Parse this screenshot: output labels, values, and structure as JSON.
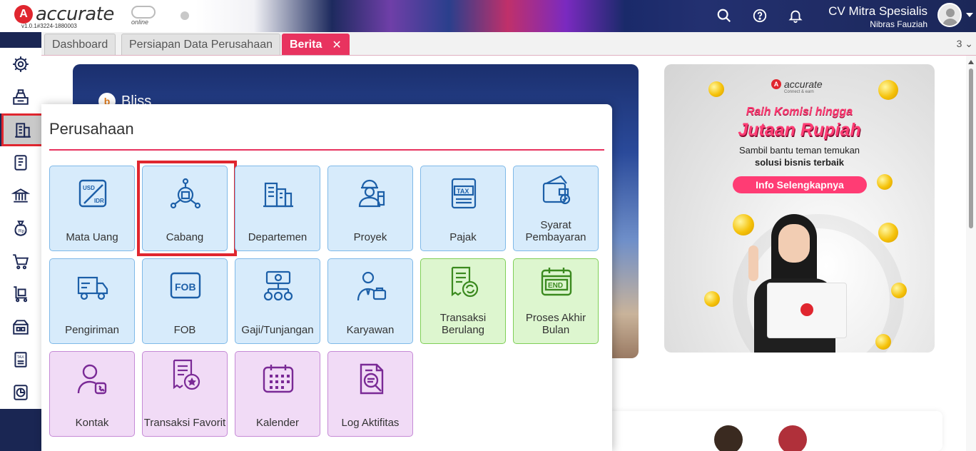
{
  "app": {
    "brand": "accurate",
    "brand_suffix": "online",
    "version": "v1.0.1#3224-1880003",
    "company_name": "CV Mitra Spesialis",
    "user_name": "Nibras Fauziah"
  },
  "topbar": {
    "icons": [
      "search-icon",
      "help-icon",
      "bell-icon"
    ]
  },
  "tabs": [
    {
      "label": "Dashboard",
      "active": false
    },
    {
      "label": "Persiapan Data Perusahaan",
      "active": false
    },
    {
      "label": "Berita",
      "active": true,
      "closable": true
    }
  ],
  "tab_count": "3",
  "sidebar": {
    "items": [
      {
        "icon": "settings-icon"
      },
      {
        "icon": "cash-register-icon"
      },
      {
        "icon": "company-icon",
        "active": true
      },
      {
        "icon": "ledger-icon"
      },
      {
        "icon": "bank-icon"
      },
      {
        "icon": "money-bag-icon"
      },
      {
        "icon": "cart-icon"
      },
      {
        "icon": "trolley-icon"
      },
      {
        "icon": "inventory-icon"
      },
      {
        "icon": "tax-icon"
      },
      {
        "icon": "report-icon"
      }
    ]
  },
  "banner_left": {
    "brand": "Bliss"
  },
  "ad": {
    "brand": "accurate",
    "brand_sub": "Connect & earn",
    "headline1": "Raih Komisi hingga",
    "headline2": "Jutaan Rupiah",
    "line1": "Sambil bantu teman temukan",
    "line2": "solusi bisnis terbaik",
    "cta": "Info Selengkapnya"
  },
  "menu": {
    "title": "Perusahaan",
    "tiles": [
      {
        "label": "Mata Uang",
        "color": "blue",
        "icon": "currency-exchange-icon"
      },
      {
        "label": "Cabang",
        "color": "blue",
        "icon": "branch-icon",
        "highlighted": true
      },
      {
        "label": "Departemen",
        "color": "blue",
        "icon": "department-building-icon"
      },
      {
        "label": "Proyek",
        "color": "blue",
        "icon": "project-worker-icon"
      },
      {
        "label": "Pajak",
        "color": "blue",
        "icon": "tax-document-icon"
      },
      {
        "label": "Syarat Pembayaran",
        "color": "blue",
        "icon": "payment-terms-icon"
      },
      {
        "label": "Pengiriman",
        "color": "blue",
        "icon": "delivery-truck-icon"
      },
      {
        "label": "FOB",
        "color": "blue",
        "icon": "fob-icon"
      },
      {
        "label": "Gaji/Tunjangan",
        "color": "blue",
        "icon": "salary-icon"
      },
      {
        "label": "Karyawan",
        "color": "blue",
        "icon": "employee-icon"
      },
      {
        "label": "Transaksi Berulang",
        "color": "green",
        "icon": "recurring-transaction-icon"
      },
      {
        "label": "Proses Akhir Bulan",
        "color": "green",
        "icon": "month-end-icon"
      },
      {
        "label": "Kontak",
        "color": "purple",
        "icon": "contact-icon"
      },
      {
        "label": "Transaksi Favorit",
        "color": "purple",
        "icon": "favorite-transaction-icon"
      },
      {
        "label": "Kalender",
        "color": "purple",
        "icon": "calendar-icon"
      },
      {
        "label": "Log Aktifitas",
        "color": "purple",
        "icon": "activity-log-icon"
      }
    ]
  },
  "colors": {
    "accent": "#e8335f",
    "sidebar": "#1a2653",
    "tile_blue_icon": "#1c5fa8",
    "tile_green_icon": "#3b8a1f",
    "tile_purple_icon": "#7a2a96",
    "highlight": "#e0262f"
  }
}
